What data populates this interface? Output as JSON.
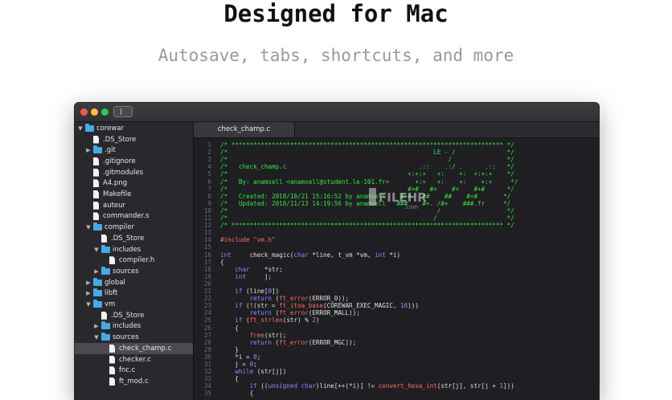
{
  "headline": "Designed for Mac",
  "subline": "Autosave, tabs, shortcuts, and more",
  "colors": {
    "folder": "#48a9e6",
    "comment": "#3ee33e",
    "keyword": "#8f8cff",
    "function": "#ff6f5a",
    "number": "#bd83ff",
    "window_bg": "#1e1e23"
  },
  "watermark": {
    "text": "FILEHR",
    "sub": ".com"
  },
  "sidebar": {
    "items": [
      {
        "label": "corewar",
        "type": "folder",
        "depth": 0,
        "expanded": true
      },
      {
        "label": ".DS_Store",
        "type": "file",
        "depth": 1
      },
      {
        "label": ".git",
        "type": "folder",
        "depth": 1,
        "expanded": false
      },
      {
        "label": ".gitignore",
        "type": "file",
        "depth": 1
      },
      {
        "label": ".gitmodules",
        "type": "file",
        "depth": 1
      },
      {
        "label": "A4.png",
        "type": "file",
        "depth": 1
      },
      {
        "label": "Makefile",
        "type": "file",
        "depth": 1
      },
      {
        "label": "auteur",
        "type": "file",
        "depth": 1
      },
      {
        "label": "commander.s",
        "type": "file",
        "depth": 1
      },
      {
        "label": "compiler",
        "type": "folder",
        "depth": 1,
        "expanded": true
      },
      {
        "label": ".DS_Store",
        "type": "file",
        "depth": 2
      },
      {
        "label": "includes",
        "type": "folder",
        "depth": 2,
        "expanded": true
      },
      {
        "label": "compiler.h",
        "type": "file",
        "depth": 3
      },
      {
        "label": "sources",
        "type": "folder",
        "depth": 2,
        "expanded": false
      },
      {
        "label": "global",
        "type": "folder",
        "depth": 1,
        "expanded": false
      },
      {
        "label": "libft",
        "type": "folder",
        "depth": 1,
        "expanded": false
      },
      {
        "label": "vm",
        "type": "folder",
        "depth": 1,
        "expanded": true
      },
      {
        "label": ".DS_Store",
        "type": "file",
        "depth": 2
      },
      {
        "label": "includes",
        "type": "folder",
        "depth": 2,
        "expanded": false
      },
      {
        "label": "sources",
        "type": "folder",
        "depth": 2,
        "expanded": true
      },
      {
        "label": "check_champ.c",
        "type": "file",
        "depth": 3,
        "selected": true
      },
      {
        "label": "checker.c",
        "type": "file",
        "depth": 3
      },
      {
        "label": "fnc.c",
        "type": "file",
        "depth": 3
      },
      {
        "label": "ft_mod.c",
        "type": "file",
        "depth": 3
      }
    ]
  },
  "tabs": [
    {
      "label": "check_champ.c",
      "active": true
    }
  ],
  "code": {
    "lines": [
      {
        "n": "1",
        "tokens": [
          [
            "c",
            "/* ************************************************************************** */"
          ]
        ]
      },
      {
        "n": "2",
        "tokens": [
          [
            "c",
            "/*                                                        LE - /              */"
          ]
        ]
      },
      {
        "n": "3",
        "tokens": [
          [
            "c",
            "/*                                                            /               */"
          ]
        ]
      },
      {
        "n": "4",
        "tokens": [
          [
            "c",
            "/*   check_champ.c                                    .::    .:/ .      .::   */"
          ]
        ]
      },
      {
        "n": "5",
        "tokens": [
          [
            "c",
            "/*                                                 +:+:+   +:    +:  +:+:+    */"
          ]
        ]
      },
      {
        "n": "6",
        "tokens": [
          [
            "c",
            "/*   By: anamsell <anamsell@student.le-101.fr>       +:+   +:    +:    +:+     */"
          ]
        ]
      },
      {
        "n": "7",
        "tokens": [
          [
            "c",
            "/*                                                 #+#   #+    #+    #+#      */"
          ]
        ]
      },
      {
        "n": "8",
        "tokens": [
          [
            "c",
            "/*   Created: 2018/10/21 15:16:52 by anamsell    #+#   ##    ##    #+#       */"
          ]
        ]
      },
      {
        "n": "9",
        "tokens": [
          [
            "c",
            "/*   Updated: 2018/11/13 14:19:56 by anamsell   ###    #+. /#+    ###.fr     */"
          ]
        ]
      },
      {
        "n": "10",
        "tokens": [
          [
            "c",
            "/*                                                         /                  */"
          ]
        ]
      },
      {
        "n": "11",
        "tokens": [
          [
            "c",
            "/*                                                        /                   */"
          ]
        ]
      },
      {
        "n": "12",
        "tokens": [
          [
            "c",
            "/* ************************************************************************** */"
          ]
        ]
      },
      {
        "n": "13",
        "tokens": []
      },
      {
        "n": "14",
        "tokens": [
          [
            "p",
            "#include \"vm.h\""
          ]
        ]
      },
      {
        "n": "15",
        "tokens": []
      },
      {
        "n": "16",
        "tokens": [
          [
            "k",
            "int"
          ],
          [
            "t",
            "     check_magic("
          ],
          [
            "k",
            "char"
          ],
          [
            "t",
            " *line, t_vm *vm, "
          ],
          [
            "k",
            "int"
          ],
          [
            "t",
            " *i)"
          ]
        ]
      },
      {
        "n": "17",
        "tokens": [
          [
            "t",
            "{"
          ]
        ]
      },
      {
        "n": "18",
        "tokens": [
          [
            "t",
            "    "
          ],
          [
            "k",
            "char"
          ],
          [
            "t",
            "    *str;"
          ]
        ]
      },
      {
        "n": "19",
        "tokens": [
          [
            "t",
            "    "
          ],
          [
            "k",
            "int"
          ],
          [
            "t",
            "     j;"
          ]
        ]
      },
      {
        "n": "20",
        "tokens": []
      },
      {
        "n": "21",
        "tokens": [
          [
            "t",
            "    "
          ],
          [
            "k",
            "if"
          ],
          [
            "t",
            " (line["
          ],
          [
            "n",
            "0"
          ],
          [
            "t",
            "])"
          ]
        ]
      },
      {
        "n": "22",
        "tokens": [
          [
            "t",
            "        "
          ],
          [
            "k",
            "return"
          ],
          [
            "t",
            " ("
          ],
          [
            "f",
            "ft_error"
          ],
          [
            "t",
            "(ERROR_0));"
          ]
        ]
      },
      {
        "n": "23",
        "tokens": [
          [
            "t",
            "    "
          ],
          [
            "k",
            "if"
          ],
          [
            "t",
            " (!(str = "
          ],
          [
            "f",
            "ft_itoa_base"
          ],
          [
            "t",
            "(COREWAR_EXEC_MAGIC, "
          ],
          [
            "n",
            "16"
          ],
          [
            "t",
            ")))"
          ]
        ]
      },
      {
        "n": "24",
        "tokens": [
          [
            "t",
            "        "
          ],
          [
            "k",
            "return"
          ],
          [
            "t",
            " ("
          ],
          [
            "f",
            "ft_error"
          ],
          [
            "t",
            "(ERROR_MALL));"
          ]
        ]
      },
      {
        "n": "25",
        "tokens": [
          [
            "t",
            "    "
          ],
          [
            "k",
            "if"
          ],
          [
            "t",
            " ("
          ],
          [
            "f",
            "ft_strlen"
          ],
          [
            "t",
            "(str) % "
          ],
          [
            "n",
            "2"
          ],
          [
            "t",
            ")"
          ]
        ]
      },
      {
        "n": "26",
        "tokens": [
          [
            "t",
            "    {"
          ]
        ]
      },
      {
        "n": "27",
        "tokens": [
          [
            "t",
            "        "
          ],
          [
            "f",
            "free"
          ],
          [
            "t",
            "(str);"
          ]
        ]
      },
      {
        "n": "28",
        "tokens": [
          [
            "t",
            "        "
          ],
          [
            "k",
            "return"
          ],
          [
            "t",
            " ("
          ],
          [
            "f",
            "ft_error"
          ],
          [
            "t",
            "(ERROR_MGC));"
          ]
        ]
      },
      {
        "n": "29",
        "tokens": [
          [
            "t",
            "    }"
          ]
        ]
      },
      {
        "n": "30",
        "tokens": [
          [
            "t",
            "    *i = "
          ],
          [
            "n",
            "0"
          ],
          [
            "t",
            ";"
          ]
        ]
      },
      {
        "n": "31",
        "tokens": [
          [
            "t",
            "    j = "
          ],
          [
            "n",
            "0"
          ],
          [
            "t",
            ";"
          ]
        ]
      },
      {
        "n": "32",
        "tokens": [
          [
            "t",
            "    "
          ],
          [
            "k",
            "while"
          ],
          [
            "t",
            " (str[j])"
          ]
        ]
      },
      {
        "n": "33",
        "tokens": [
          [
            "t",
            "    {"
          ]
        ]
      },
      {
        "n": "34",
        "tokens": [
          [
            "t",
            "        "
          ],
          [
            "k",
            "if"
          ],
          [
            "t",
            " (("
          ],
          [
            "k",
            "unsigned char"
          ],
          [
            "t",
            ")line[++(*i)] != "
          ],
          [
            "f",
            "convert_hexa_int"
          ],
          [
            "t",
            "(str[j], str[j + "
          ],
          [
            "n",
            "1"
          ],
          [
            "t",
            "]))"
          ]
        ]
      },
      {
        "n": "35",
        "tokens": [
          [
            "t",
            "        {"
          ]
        ]
      }
    ]
  }
}
